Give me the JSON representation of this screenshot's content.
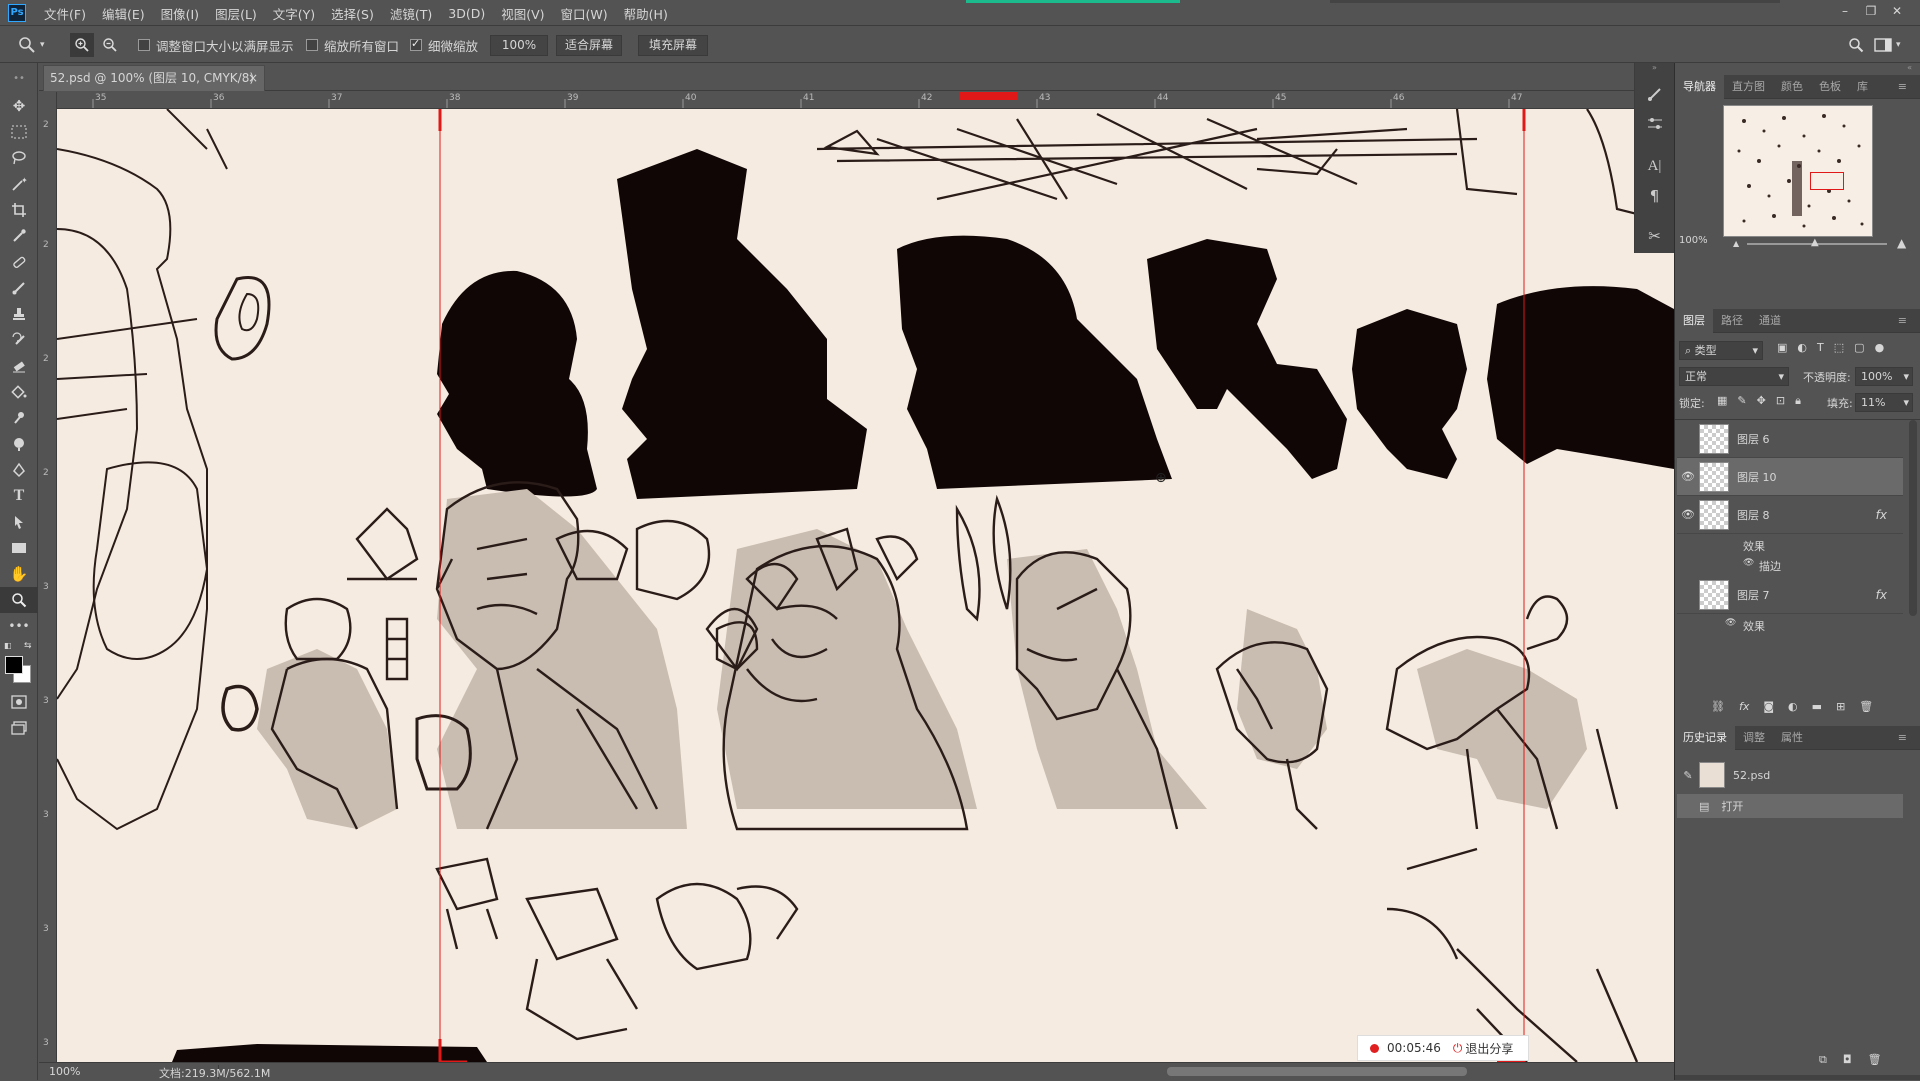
{
  "app": {
    "logo": "Ps"
  },
  "menu": [
    "文件(F)",
    "编辑(E)",
    "图像(I)",
    "图层(L)",
    "文字(Y)",
    "选择(S)",
    "滤镜(T)",
    "3D(D)",
    "视图(V)",
    "窗口(W)",
    "帮助(H)"
  ],
  "window_controls": {
    "minimize": "–",
    "restore": "❐",
    "close": "✕"
  },
  "options": {
    "zoom_tool_icon": "zoom-icon",
    "resize_windows": "调整窗口大小以满屏显示",
    "resize_windows_checked": false,
    "zoom_all": "缩放所有窗口",
    "zoom_all_checked": false,
    "scrubby_zoom": "细微缩放",
    "scrubby_zoom_checked": true,
    "zoom_pct": "100%",
    "fit_screen": "适合屏幕",
    "fill_screen": "填充屏幕"
  },
  "document": {
    "tab_title": "52.psd @ 100% (图层 10, CMYK/8)",
    "tab_close": "×"
  },
  "ruler_h": [
    "35",
    "36",
    "37",
    "38",
    "39",
    "40",
    "41",
    "42",
    "43",
    "44",
    "45",
    "46",
    "47"
  ],
  "ruler_v": [
    "2",
    "2",
    "2",
    "2",
    "3",
    "3",
    "3",
    "3",
    "3"
  ],
  "status": {
    "zoom": "100%",
    "doc_info": "文档:219.3M/562.1M",
    "arrow": "›"
  },
  "recording": {
    "time": "00:05:46",
    "exit": "退出分享"
  },
  "navigator": {
    "tabs": [
      "导航器",
      "直方图",
      "颜色",
      "色板",
      "库"
    ],
    "zoom": "100%"
  },
  "layers_panel": {
    "tabs": [
      "图层",
      "路径",
      "通道"
    ],
    "filter_kind": "类型",
    "blend_mode": "正常",
    "opacity_label": "不透明度:",
    "opacity_value": "100%",
    "lock_label": "锁定:",
    "fill_label": "填充:",
    "fill_value": "11%",
    "layers": [
      {
        "name": "图层 6",
        "visible": false,
        "fx": false,
        "selected": false
      },
      {
        "name": "图层 10",
        "visible": true,
        "fx": false,
        "selected": true
      },
      {
        "name": "图层 8",
        "visible": true,
        "fx": true,
        "selected": false
      },
      {
        "name": "图层 7",
        "visible": false,
        "fx": true,
        "selected": false
      }
    ],
    "effects_label": "效果",
    "stroke_label": "描边",
    "fx_symbol": "fx"
  },
  "history_panel": {
    "tabs": [
      "历史记录",
      "调整",
      "属性"
    ],
    "snapshot": "52.psd",
    "items": [
      "打开"
    ]
  },
  "colors": {
    "canvas": "#f6ebe0",
    "guide_red": "#e01818",
    "accent_green": "#1bbb8e"
  }
}
